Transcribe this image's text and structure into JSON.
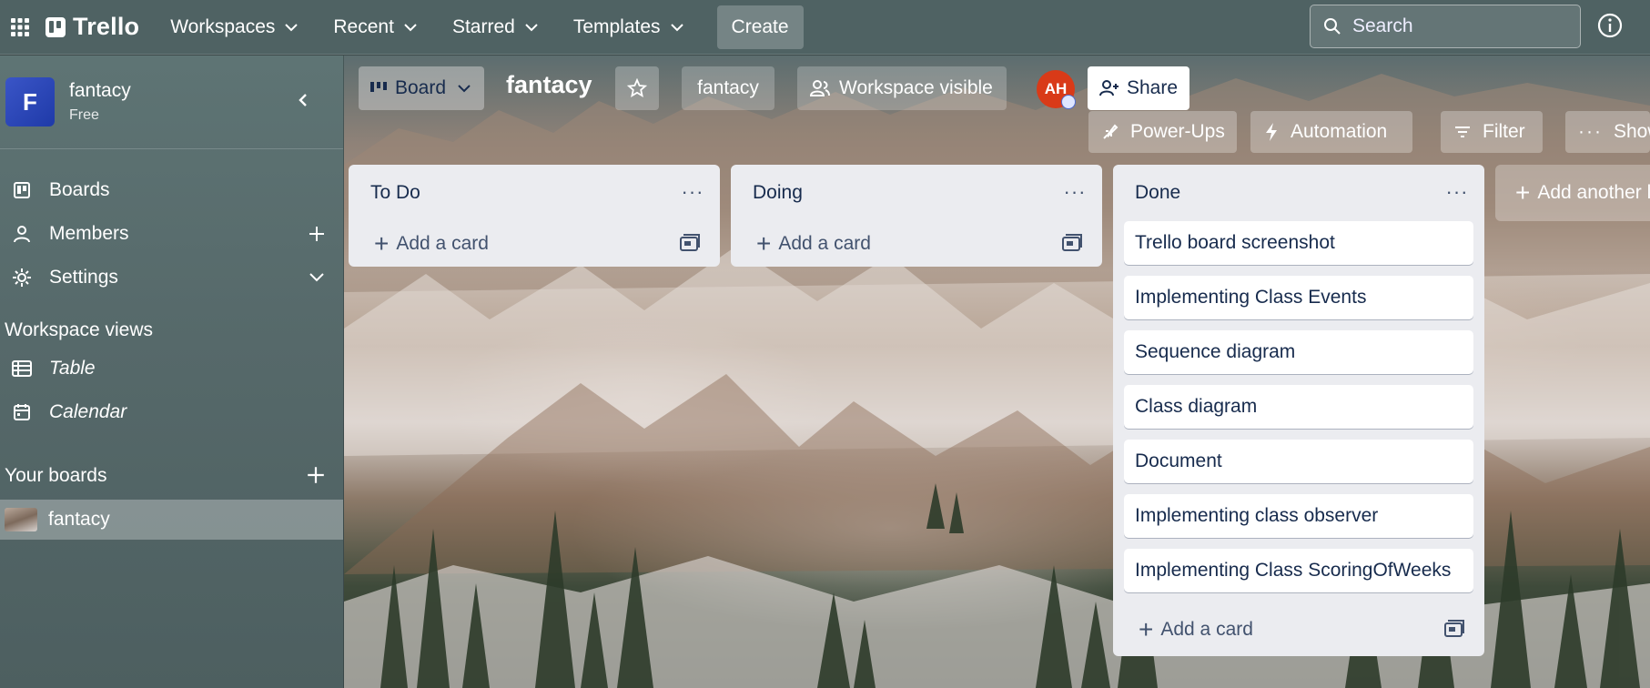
{
  "topnav": {
    "logo": "Trello",
    "menus": [
      "Workspaces",
      "Recent",
      "Starred",
      "Templates"
    ],
    "create": "Create",
    "search_placeholder": "Search"
  },
  "sidebar": {
    "workspace_initial": "F",
    "workspace_name": "fantacy",
    "workspace_plan": "Free",
    "items": [
      {
        "label": "Boards",
        "icon": "board-icon"
      },
      {
        "label": "Members",
        "icon": "person-icon"
      },
      {
        "label": "Settings",
        "icon": "gear-icon"
      }
    ],
    "views_title": "Workspace views",
    "views": [
      {
        "label": "Table",
        "icon": "table-icon"
      },
      {
        "label": "Calendar",
        "icon": "calendar-icon"
      }
    ],
    "your_boards_title": "Your boards",
    "boards": [
      {
        "label": "fantacy",
        "active": true
      }
    ]
  },
  "board": {
    "view": "Board",
    "title": "fantacy",
    "workspace": "fantacy",
    "visibility": "Workspace visible",
    "member_initials": "AH",
    "share": "Share",
    "tools": [
      "Power-Ups",
      "Automation",
      "Filter",
      "Show"
    ],
    "add_list": "Add another list",
    "lists": [
      {
        "title": "To Do",
        "cards": [],
        "add_card": "Add a card"
      },
      {
        "title": "Doing",
        "cards": [],
        "add_card": "Add a card"
      },
      {
        "title": "Done",
        "cards": [
          "Trello board screenshot",
          "Implementing Class Events",
          "Sequence diagram",
          "Class diagram",
          "Document",
          "Implementing class observer",
          "Implementing Class ScoringOfWeeks"
        ],
        "add_card": "Add a card"
      }
    ]
  },
  "colors": {
    "nav": "#4f6263",
    "sidebar": "#56696a",
    "list_bg": "#ebecf0",
    "avatar_red": "#d93a18",
    "workspace_blue": "#2a45b8"
  }
}
